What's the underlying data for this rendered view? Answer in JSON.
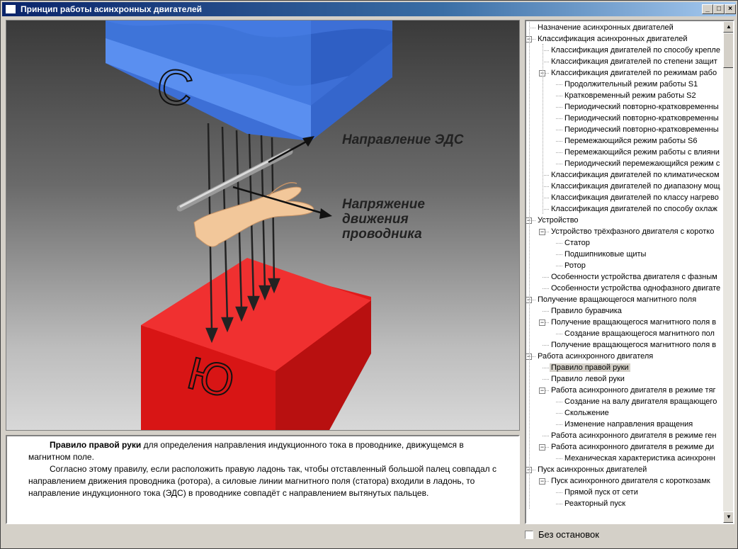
{
  "window": {
    "title": "Принцип работы асинхронных двигателей",
    "controls": {
      "minimize": "_",
      "maximize": "□",
      "close": "×"
    }
  },
  "scene": {
    "north_letter": "С",
    "south_letter": "Ю",
    "label_emf": "Направление ЭДС",
    "label_motion_1": "Напряжение",
    "label_motion_2": "движения",
    "label_motion_3": "проводника"
  },
  "description": {
    "heading": "Правило правой руки",
    "line1": " для определения направления индукционного тока в проводнике, движущемся в магнитном поле.",
    "line2": "Согласно этому правилу, если расположить правую ладонь так, чтобы отставленный большой палец совпадал с направлением движения проводника (ротора), а силовые линии магнитного поля (статора) входили в ладонь, то направление индукционного тока (ЭДС) в проводнике  совпадёт с направлением вытянутых пальцев."
  },
  "tree": {
    "items": [
      {
        "label": "Назначение асинхронных двигателей",
        "level": 0,
        "expander": ""
      },
      {
        "label": "Классификация асинхронных двигателей",
        "level": 0,
        "expander": "−"
      },
      {
        "label": "Классификация двигателей по способу крепле",
        "level": 1,
        "expander": ""
      },
      {
        "label": "Классификация двигателей по степени защит",
        "level": 1,
        "expander": ""
      },
      {
        "label": "Классификация  двигателей по режимам рабо",
        "level": 1,
        "expander": "−"
      },
      {
        "label": "Продолжительный режим работы S1",
        "level": 2,
        "expander": ""
      },
      {
        "label": "Кратковременный режим работы S2",
        "level": 2,
        "expander": ""
      },
      {
        "label": "Периодический повторно-кратковременны",
        "level": 2,
        "expander": ""
      },
      {
        "label": "Периодический повторно-кратковременны",
        "level": 2,
        "expander": ""
      },
      {
        "label": "Периодический повторно-кратковременны",
        "level": 2,
        "expander": ""
      },
      {
        "label": "Перемежающийся режим работы S6",
        "level": 2,
        "expander": ""
      },
      {
        "label": "Перемежающийся режим работы с влияни",
        "level": 2,
        "expander": ""
      },
      {
        "label": "Периодический перемежающийся режим с",
        "level": 2,
        "expander": ""
      },
      {
        "label": "Классификация двигателей по климатическом",
        "level": 1,
        "expander": ""
      },
      {
        "label": "Классификация двигателей по диапазону мощ",
        "level": 1,
        "expander": ""
      },
      {
        "label": "Классификация двигателей по классу нагрево",
        "level": 1,
        "expander": ""
      },
      {
        "label": "Классификация двигателей  по способу охлаж",
        "level": 1,
        "expander": ""
      },
      {
        "label": "Устройство",
        "level": 0,
        "expander": "−"
      },
      {
        "label": "Устройство трёхфазного двигателя с коротко",
        "level": 1,
        "expander": "−"
      },
      {
        "label": "Статор",
        "level": 2,
        "expander": ""
      },
      {
        "label": "Подшипниковые щиты",
        "level": 2,
        "expander": ""
      },
      {
        "label": "Ротор",
        "level": 2,
        "expander": ""
      },
      {
        "label": "Особенности устройства двигателя с фазным",
        "level": 1,
        "expander": ""
      },
      {
        "label": "Особенности устройства однофазного двигате",
        "level": 1,
        "expander": ""
      },
      {
        "label": "Получение вращающегося магнитного поля",
        "level": 0,
        "expander": "−"
      },
      {
        "label": "Правило буравчика",
        "level": 1,
        "expander": ""
      },
      {
        "label": "Получение вращающегося магнитного поля в",
        "level": 1,
        "expander": "−"
      },
      {
        "label": "Создание вращающегося  магнитного пол",
        "level": 2,
        "expander": ""
      },
      {
        "label": "Получение вращающегося магнитного поля в",
        "level": 1,
        "expander": ""
      },
      {
        "label": "Работа асинхронного двигателя",
        "level": 0,
        "expander": "−"
      },
      {
        "label": "Правило правой руки",
        "level": 1,
        "expander": "",
        "selected": true
      },
      {
        "label": "Правило левой руки",
        "level": 1,
        "expander": ""
      },
      {
        "label": "Работа асинхронного двигателя в режиме тяг",
        "level": 1,
        "expander": "−"
      },
      {
        "label": "Создание на валу двигателя вращающего",
        "level": 2,
        "expander": ""
      },
      {
        "label": "Скольжение",
        "level": 2,
        "expander": ""
      },
      {
        "label": "Изменение направления вращения",
        "level": 2,
        "expander": ""
      },
      {
        "label": "Работа асинхронного двигателя в режиме ген",
        "level": 1,
        "expander": ""
      },
      {
        "label": "Работа асинхронного двигателя в режиме ди",
        "level": 1,
        "expander": "−"
      },
      {
        "label": "Механическая характеристика асинхронн",
        "level": 2,
        "expander": ""
      },
      {
        "label": "Пуск асинхронных двигателей",
        "level": 0,
        "expander": "−"
      },
      {
        "label": "Пуск асинхронного двигателя с  короткозамк",
        "level": 1,
        "expander": "−"
      },
      {
        "label": "Прямой пуск от сети",
        "level": 2,
        "expander": ""
      },
      {
        "label": "Реакторный пуск",
        "level": 2,
        "expander": ""
      }
    ]
  },
  "options": {
    "no_stops_label": "Без остановок",
    "no_stops_checked": false
  },
  "colors": {
    "north_pole": "#4a7fe0",
    "south_pole": "#e02020",
    "titlebar": "#0a246a"
  }
}
